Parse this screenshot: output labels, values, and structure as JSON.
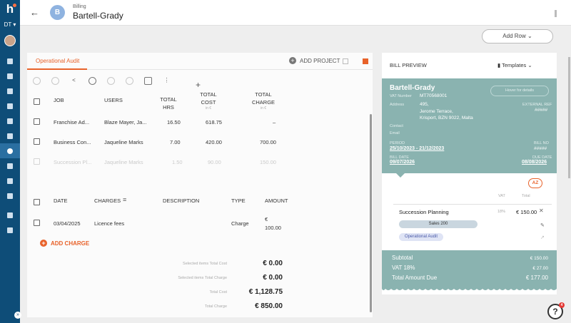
{
  "sidebar": {
    "logo": "h",
    "org": "DT ▾",
    "collapse": "»",
    "items": [
      "dashboard-icon",
      "grid-icon",
      "clock-icon",
      "people-icon",
      "copy-icon",
      "billing-icon",
      "tag-icon",
      "card-icon",
      "report-icon",
      "group-icon",
      "settings-icon",
      "power-icon"
    ]
  },
  "header": {
    "back": "←",
    "avatar": "B",
    "breadcrumb": "Billing",
    "title": "Bartell-Grady"
  },
  "add_row": "Add Row ⌄",
  "left": {
    "tab": "Operational Audit",
    "add_project": "ADD PROJECT",
    "plus": "+",
    "jobs_headers": {
      "job": "JOB",
      "users": "USERS",
      "hrs": "TOTAL HRS",
      "cost": "TOTAL COST",
      "cost_unit": "in €",
      "charge": "TOTAL CHARGE",
      "charge_unit": "in €"
    },
    "jobs": [
      {
        "job": "Franchise Ad...",
        "users": "Blaze Mayer, Ja...",
        "hrs": "16.50",
        "cost": "618.75",
        "charge": "–"
      },
      {
        "job": "Business Con...",
        "users": "Jaqueline Marks",
        "hrs": "7.00",
        "cost": "420.00",
        "charge": "700.00"
      },
      {
        "job": "Succession Pl...",
        "users": "Jaqueline Marks",
        "hrs": "1.50",
        "cost": "90.00",
        "charge": "150.00"
      }
    ],
    "charges_headers": {
      "date": "DATE",
      "charges": "CHARGES",
      "description": "DESCRIPTION",
      "type": "TYPE",
      "amount": "AMOUNT"
    },
    "charges": [
      {
        "date": "03/04/2025",
        "charges": "Licence fees",
        "type": "Charge",
        "currency": "€",
        "amount": "100.00"
      }
    ],
    "add_charge": "ADD CHARGE",
    "totals": [
      {
        "label": "Selected items Total Cost",
        "value": "€ 0.00"
      },
      {
        "label": "Selected items Total Charge",
        "value": "€ 0.00"
      },
      {
        "label": "Total Cost",
        "value": "€ 1,128.75"
      },
      {
        "label": "Total Charge",
        "value": "€ 850.00"
      }
    ]
  },
  "bill": {
    "title": "BILL PREVIEW",
    "templates": "Templates",
    "client": "Bartell-Grady",
    "hint": "Hover for details",
    "vat_label": "VAT Number",
    "vat_value": "MT70568001",
    "address_label": "Address",
    "address_lines": [
      "495,",
      "Jerome Terrace,",
      "Krisport, BZN 9022, Malta"
    ],
    "contact_label": "Contact",
    "email_label": "Email",
    "external_label": "EXTERNAL REF",
    "external_value": "#####",
    "period_label": "PERIOD",
    "period_value": "25/10/2023 - 21/12/2023",
    "billno_label": "BILL NO",
    "billno_value": "#####",
    "billdate_label": "BILL DATE",
    "billdate_value": "09/07/2026",
    "duedate_label": "DUE DATE",
    "duedate_value": "08/08/2026",
    "az": "AZ",
    "col_vat": "VAT",
    "col_total": "Total",
    "item_name": "Succession Planning",
    "item_vat": "18%",
    "item_amount": "€ 150.00",
    "item_sales": "Sales  200",
    "item_project": "Operational Audit",
    "subtotal_label": "Subtotal",
    "subtotal_value": "€ 150.00",
    "vat_total_label": "VAT 18%",
    "vat_total_value": "€ 27.00",
    "due_label": "Total Amount Due",
    "due_value": "€ 177.00"
  },
  "help": "?",
  "help_badge": "4",
  "colors": {
    "sidebar": "#0e4d78",
    "accent": "#e8622a",
    "teal": "#8ab3b0"
  }
}
